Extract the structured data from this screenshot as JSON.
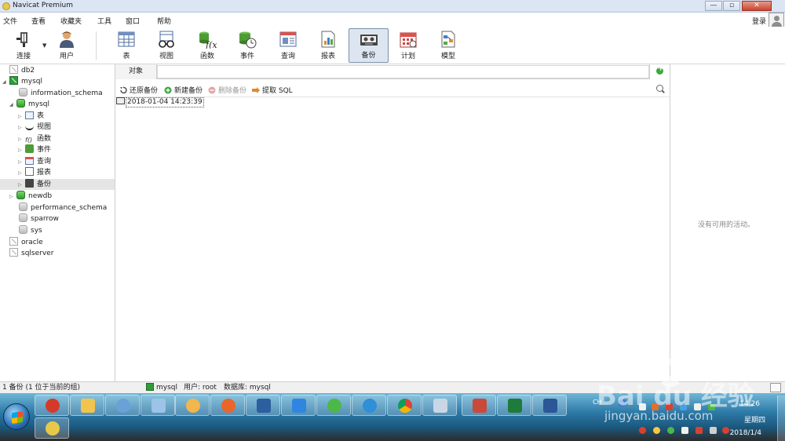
{
  "window": {
    "title": "Navicat Premium",
    "minimize": "—",
    "maximize": "▫",
    "close": "✕"
  },
  "menu": {
    "items": [
      "文件",
      "查看",
      "收藏夹",
      "工具",
      "窗口",
      "帮助"
    ],
    "login": "登录"
  },
  "toolbar": {
    "items": [
      {
        "label": "连接",
        "icon": "plug-icon"
      },
      {
        "label": "用户",
        "icon": "user-icon"
      },
      {
        "label": "表",
        "icon": "table-icon"
      },
      {
        "label": "视图",
        "icon": "view-glasses-icon"
      },
      {
        "label": "函数",
        "icon": "function-icon"
      },
      {
        "label": "事件",
        "icon": "event-clock-icon"
      },
      {
        "label": "查询",
        "icon": "query-icon"
      },
      {
        "label": "报表",
        "icon": "report-icon"
      },
      {
        "label": "备份",
        "icon": "backup-tape-icon"
      },
      {
        "label": "计划",
        "icon": "calendar-icon"
      },
      {
        "label": "模型",
        "icon": "model-icon"
      }
    ],
    "active": "备份"
  },
  "tree": {
    "nodes": [
      {
        "label": "db2",
        "icon": "conn-gray"
      },
      {
        "label": "mysql",
        "icon": "conn-green"
      },
      {
        "label": "information_schema",
        "icon": "db-gray"
      },
      {
        "label": "mysql",
        "icon": "db-green"
      },
      {
        "label": "表",
        "icon": "table-icon"
      },
      {
        "label": "视图",
        "icon": "view-glasses-icon"
      },
      {
        "label": "函数",
        "icon": "function-icon"
      },
      {
        "label": "事件",
        "icon": "event-clock-icon"
      },
      {
        "label": "查询",
        "icon": "query-icon"
      },
      {
        "label": "报表",
        "icon": "report-icon"
      },
      {
        "label": "备份",
        "icon": "backup-tape-icon"
      },
      {
        "label": "newdb",
        "icon": "db-green"
      },
      {
        "label": "performance_schema",
        "icon": "db-gray"
      },
      {
        "label": "sparrow",
        "icon": "db-gray"
      },
      {
        "label": "sys",
        "icon": "db-gray"
      },
      {
        "label": "oracle",
        "icon": "conn-gray"
      },
      {
        "label": "sqlserver",
        "icon": "conn-gray"
      }
    ]
  },
  "tabs": {
    "object": "对象"
  },
  "actions": {
    "restore": "还原备份",
    "new": "新建备份",
    "delete": "删除备份",
    "extract": "提取 SQL"
  },
  "content": {
    "backup_file": "2018-01-04 14:23:39"
  },
  "right_panel": {
    "message": "没有可用的活动。"
  },
  "status": {
    "count": "1 备份 (1 位于当前的组)",
    "connection": "mysql",
    "user": "用户: root",
    "database": "数据库: mysql"
  },
  "taskbar": {
    "ime": "CH",
    "time": "14:26",
    "weekday": "星期四",
    "date": "2018/1/4"
  },
  "watermark": {
    "brand": "Bai du 经验",
    "url": "jingyan.baidu.com"
  }
}
